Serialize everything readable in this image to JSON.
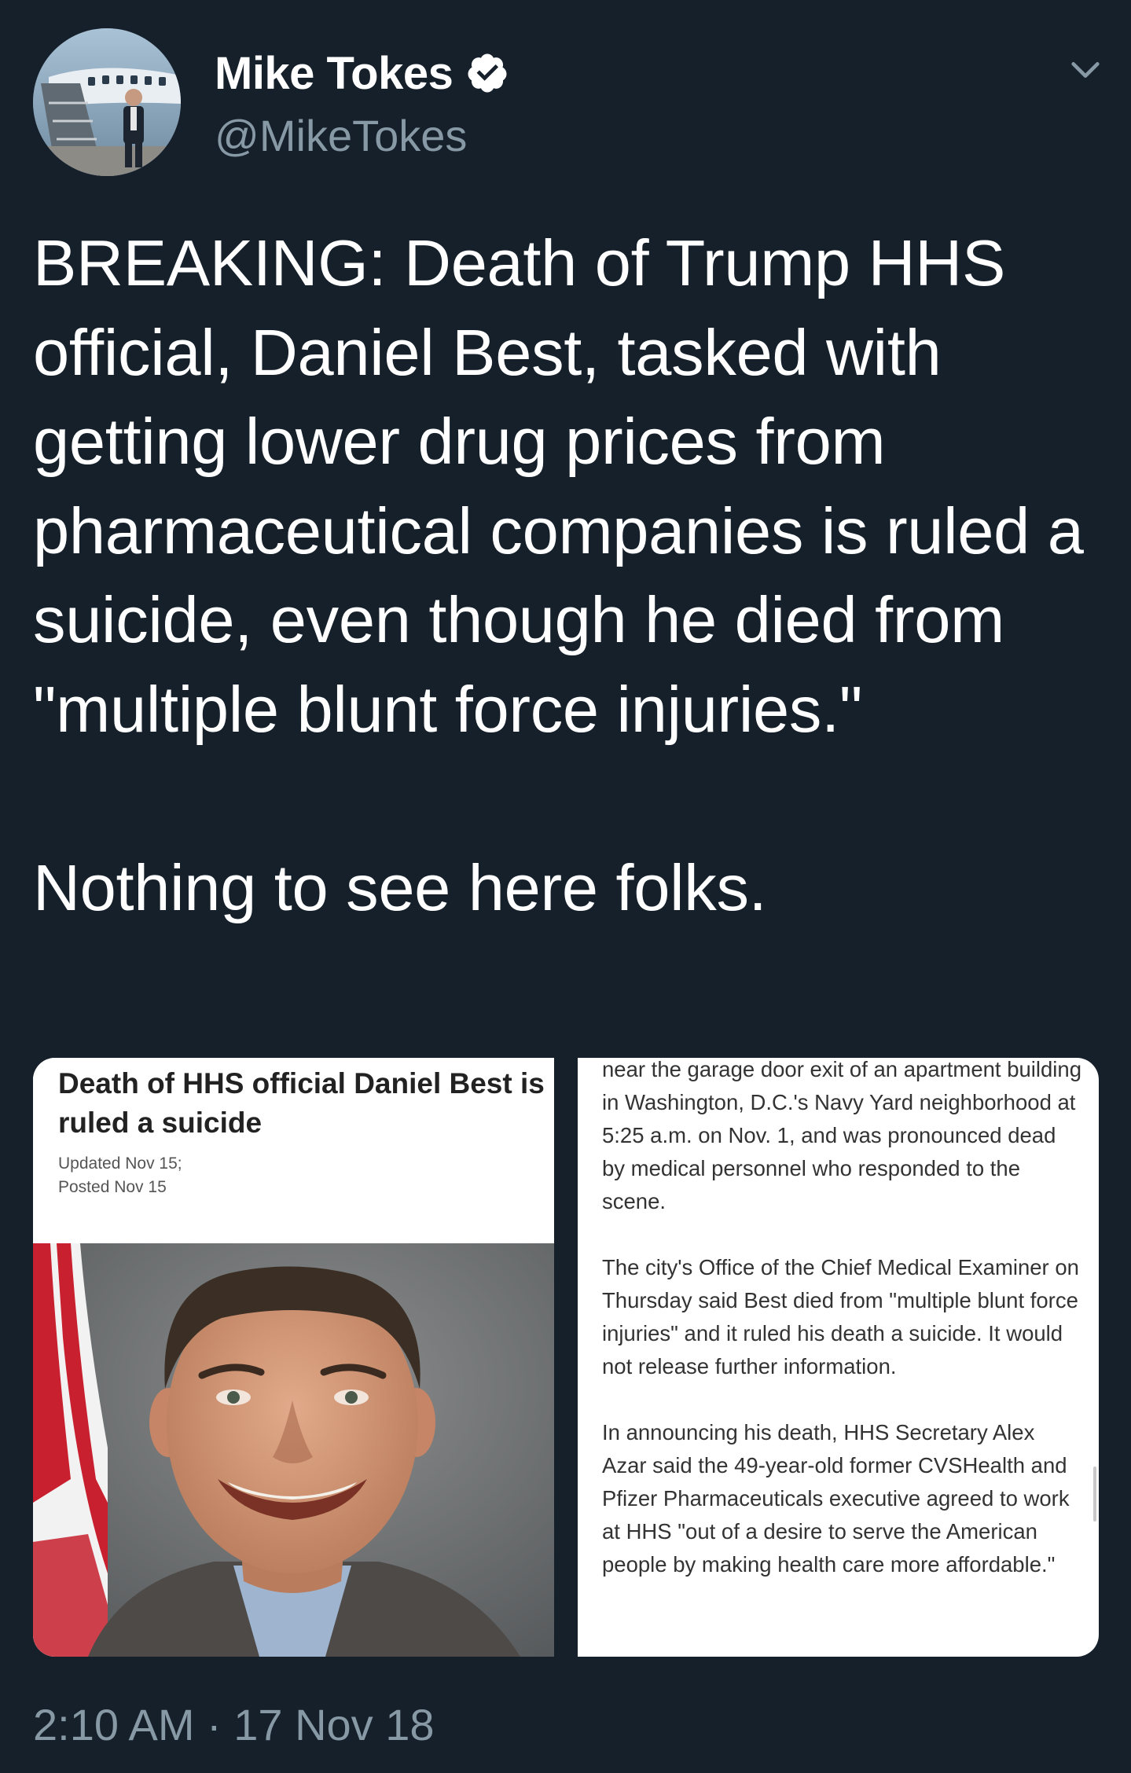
{
  "tweet": {
    "author": {
      "display_name": "Mike Tokes",
      "handle": "@MikeTokes",
      "verified": true,
      "verified_icon": "verified-badge-icon"
    },
    "text": "BREAKING: Death of Trump HHS official, Daniel Best, tasked with getting lower drug prices from pharmaceutical companies is ruled a suicide, even though he died from \"multiple blunt force injuries.\"\n\nNothing to see here folks.",
    "more_icon": "chevron-down-icon",
    "timestamp": "2:10 AM · 17 Nov 18"
  },
  "media": {
    "left": {
      "headline": "Death of HHS official Daniel Best is ruled a suicide",
      "updated": "Updated Nov 15;",
      "posted": "Posted Nov 15"
    },
    "right": {
      "paragraphs": [
        "near the garage door exit of an apartment building in Washington, D.C.'s Navy Yard neighborhood at 5:25 a.m. on Nov. 1, and was pronounced dead by medical personnel who responded to the scene.",
        "The city's Office of the Chief Medical Examiner on Thursday said Best died from \"multiple blunt force injuries\" and it ruled his death a suicide. It would not release further information.",
        "In announcing his death, HHS Secretary Alex Azar said the 49-year-old former CVSHealth and Pfizer Pharmaceuticals executive agreed to work at HHS \"out of a desire to serve the American people by making health care more affordable.\""
      ]
    }
  },
  "colors": {
    "background": "#15202b",
    "primary_text": "#ffffff",
    "secondary_text": "#8899a6",
    "article_bg": "#ffffff",
    "flag_red": "#c8202f"
  }
}
